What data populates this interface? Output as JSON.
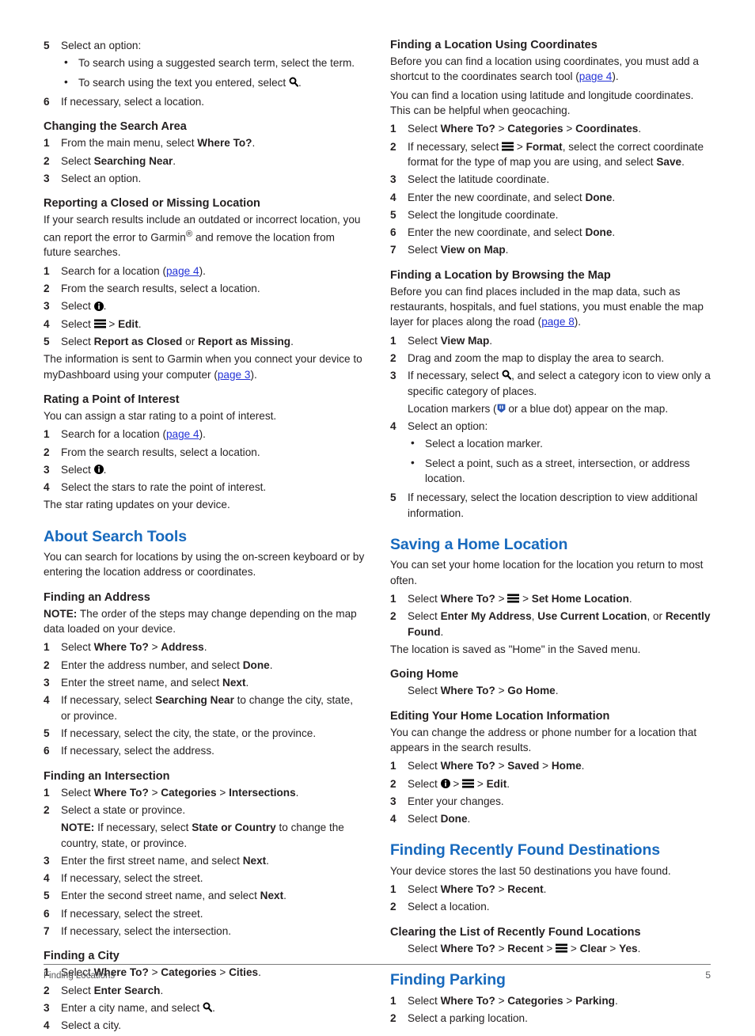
{
  "footer": {
    "section_title": "Finding Locations",
    "page_number": "5"
  },
  "colors": {
    "heading_blue": "#1769bd",
    "link_blue": "#2433d6",
    "body_text": "#231f20",
    "footer_text": "#58595b"
  },
  "icons": {
    "search": "search-icon",
    "menu": "menu-icon",
    "info": "info-icon",
    "marker": "map-marker-icon"
  },
  "left_column": {
    "step5_label": "5",
    "step5_text": "Select an option:",
    "step5_bullets": [
      {
        "marker": "•",
        "pre": "To search using a suggested search term, select the term.",
        "post": ""
      },
      {
        "marker": "•",
        "pre": "To search using the text you entered, select ",
        "post": "."
      }
    ],
    "step6_label": "6",
    "step6_text": "If necessary, select a location.",
    "changing_search_area": {
      "heading": "Changing the Search Area",
      "steps": [
        {
          "num": "1",
          "pre": "From the main menu, select ",
          "bold": "Where To?",
          "post": "."
        },
        {
          "num": "2",
          "pre": "Select ",
          "bold": "Searching Near",
          "post": "."
        },
        {
          "num": "3",
          "pre": "Select an option.",
          "bold": "",
          "post": ""
        }
      ]
    },
    "reporting_closed": {
      "heading": "Reporting a Closed or Missing Location",
      "intro_a": "If your search results include an outdated or incorrect location, you can report the error to Garmin",
      "intro_sup": "®",
      "intro_b": " and remove the location from future searches.",
      "step1_num": "1",
      "step1_pre": "Search for a location (",
      "step1_link": "page 4",
      "step1_post": ").",
      "step2_num": "2",
      "step2_text": "From the search results, select a location.",
      "step3_num": "3",
      "step3_pre": "Select ",
      "step3_post": ".",
      "step4_num": "4",
      "step4_pre": "Select ",
      "step4_mid": " > ",
      "step4_bold": "Edit",
      "step4_post": ".",
      "step5_num": "5",
      "step5_pre": "Select ",
      "step5_bold1": "Report as Closed",
      "step5_mid": " or ",
      "step5_bold2": "Report as Missing",
      "step5_post": ".",
      "outro_pre": "The information is sent to Garmin when you connect your device to myDashboard using your computer (",
      "outro_link": "page 3",
      "outro_post": ")."
    },
    "rating_poi": {
      "heading": "Rating a Point of Interest",
      "intro": "You can assign a star rating to a point of interest.",
      "step1_num": "1",
      "step1_pre": "Search for a location (",
      "step1_link": "page 4",
      "step1_post": ").",
      "step2_num": "2",
      "step2_text": "From the search results, select a location.",
      "step3_num": "3",
      "step3_pre": "Select ",
      "step3_post": ".",
      "step4_num": "4",
      "step4_text": "Select the stars to rate the point of interest.",
      "outro": "The star rating updates on your device."
    },
    "about_search_tools": {
      "heading": "About Search Tools",
      "intro": "You can search for locations by using the on-screen keyboard or by entering the location address or coordinates."
    },
    "finding_address": {
      "heading": "Finding an Address",
      "note_label": "NOTE:",
      "note_text": " The order of the steps may change depending on the map data loaded on your device.",
      "steps": [
        {
          "num": "1",
          "pre": "Select ",
          "bold": "Where To?",
          "mid": " > ",
          "bold2": "Address",
          "post": "."
        },
        {
          "num": "2",
          "pre": "Enter the address number, and select ",
          "bold": "Done",
          "mid": "",
          "bold2": "",
          "post": "."
        },
        {
          "num": "3",
          "pre": "Enter the street name, and select ",
          "bold": "Next",
          "mid": "",
          "bold2": "",
          "post": "."
        },
        {
          "num": "4",
          "pre": "If necessary, select ",
          "bold": "Searching Near",
          "mid": " to change the city, state, or province.",
          "bold2": "",
          "post": ""
        },
        {
          "num": "5",
          "pre": "If necessary, select the city, the state, or the province.",
          "bold": "",
          "mid": "",
          "bold2": "",
          "post": ""
        },
        {
          "num": "6",
          "pre": "If necessary, select the address.",
          "bold": "",
          "mid": "",
          "bold2": "",
          "post": ""
        }
      ]
    },
    "finding_intersection": {
      "heading": "Finding an Intersection",
      "step1_num": "1",
      "step1_pre": "Select ",
      "step1_b1": "Where To?",
      "step1_m1": " > ",
      "step1_b2": "Categories",
      "step1_m2": " > ",
      "step1_b3": "Intersections",
      "step1_post": ".",
      "step2_num": "2",
      "step2_text": "Select a state or province.",
      "step2_note_label": "NOTE:",
      "step2_note_pre": " If necessary, select ",
      "step2_note_bold": "State or Country",
      "step2_note_post": " to change the country, state, or province.",
      "steps_rest": [
        {
          "num": "3",
          "pre": "Enter the first street name, and select ",
          "bold": "Next",
          "post": "."
        },
        {
          "num": "4",
          "pre": "If necessary, select the street.",
          "bold": "",
          "post": ""
        },
        {
          "num": "5",
          "pre": "Enter the second street name, and select ",
          "bold": "Next",
          "post": "."
        },
        {
          "num": "6",
          "pre": "If necessary, select the street.",
          "bold": "",
          "post": ""
        },
        {
          "num": "7",
          "pre": "If necessary, select the intersection.",
          "bold": "",
          "post": ""
        }
      ]
    },
    "finding_city": {
      "heading": "Finding a City",
      "step1_num": "1",
      "step1_pre": "Select ",
      "step1_b1": "Where To?",
      "step1_m1": " > ",
      "step1_b2": "Categories",
      "step1_m2": " > ",
      "step1_b3": "Cities",
      "step1_post": ".",
      "step2_num": "2",
      "step2_pre": "Select ",
      "step2_bold": "Enter Search",
      "step2_post": ".",
      "step3_num": "3",
      "step3_pre": "Enter a city name, and select ",
      "step3_post": ".",
      "step4_num": "4",
      "step4_text": "Select a city."
    }
  },
  "right_column": {
    "finding_coordinates": {
      "heading": "Finding a Location Using Coordinates",
      "intro_pre": "Before you can find a location using coordinates, you must add a shortcut to the coordinates search tool (",
      "intro_link": "page 4",
      "intro_post": ").",
      "intro2": "You can find a location using latitude and longitude coordinates. This can be helpful when geocaching.",
      "step1_num": "1",
      "step1_pre": "Select ",
      "step1_b1": "Where To?",
      "step1_m1": " > ",
      "step1_b2": "Categories",
      "step1_m2": " > ",
      "step1_b3": "Coordinates",
      "step1_post": ".",
      "step2_num": "2",
      "step2_pre": "If necessary, select ",
      "step2_mid": " > ",
      "step2_bold": "Format",
      "step2_mid2": ", select the correct coordinate format for the type of map you are using, and select ",
      "step2_bold2": "Save",
      "step2_post": ".",
      "steps_rest": [
        {
          "num": "3",
          "pre": "Select the latitude coordinate.",
          "bold": "",
          "post": ""
        },
        {
          "num": "4",
          "pre": "Enter the new coordinate, and select ",
          "bold": "Done",
          "post": "."
        },
        {
          "num": "5",
          "pre": "Select the longitude coordinate.",
          "bold": "",
          "post": ""
        },
        {
          "num": "6",
          "pre": "Enter the new coordinate, and select ",
          "bold": "Done",
          "post": "."
        },
        {
          "num": "7",
          "pre": "Select ",
          "bold": "View on Map",
          "post": "."
        }
      ]
    },
    "browsing_map": {
      "heading": "Finding a Location by Browsing the Map",
      "intro_pre": "Before you can find places included in the map data, such as restaurants, hospitals, and fuel stations, you must enable the map layer for places along the road (",
      "intro_link": "page 8",
      "intro_post": ").",
      "step1_num": "1",
      "step1_pre": "Select ",
      "step1_bold": "View Map",
      "step1_post": ".",
      "step2_num": "2",
      "step2_text": "Drag and zoom the map to display the area to search.",
      "step3_num": "3",
      "step3_pre": "If necessary, select ",
      "step3_post": ", and select a category icon to view only a specific category of places.",
      "step3_sub_pre": "Location markers (",
      "step3_sub_post": " or a blue dot) appear on the map.",
      "step4_num": "4",
      "step4_text": "Select an option:",
      "step4_bullets": [
        {
          "marker": "•",
          "text": "Select a location marker."
        },
        {
          "marker": "•",
          "text": "Select a point, such as a street, intersection, or address location."
        }
      ],
      "step5_num": "5",
      "step5_text": "If necessary, select the location description to view additional information."
    },
    "saving_home": {
      "heading": "Saving a Home Location",
      "intro": "You can set your home location for the location you return to most often.",
      "step1_num": "1",
      "step1_pre": "Select ",
      "step1_bold": "Where To?",
      "step1_m1": " > ",
      "step1_m2": " > ",
      "step1_bold2": "Set Home Location",
      "step1_post": ".",
      "step2_num": "2",
      "step2_pre": "Select ",
      "step2_b1": "Enter My Address",
      "step2_m1": ", ",
      "step2_b2": "Use Current Location",
      "step2_m2": ", or ",
      "step2_b3": "Recently Found",
      "step2_post": ".",
      "outro": "The location is saved as \"Home\" in the Saved menu."
    },
    "going_home": {
      "heading": "Going Home",
      "pre": "Select ",
      "b1": "Where To?",
      "m1": " > ",
      "b2": "Go Home",
      "post": "."
    },
    "editing_home": {
      "heading": "Editing Your Home Location Information",
      "intro": "You can change the address or phone number for a location that appears in the search results.",
      "step1_num": "1",
      "step1_pre": "Select ",
      "step1_b1": "Where To?",
      "step1_m1": " > ",
      "step1_b2": "Saved",
      "step1_m2": " > ",
      "step1_b3": "Home",
      "step1_post": ".",
      "step2_num": "2",
      "step2_pre": "Select ",
      "step2_m1": " > ",
      "step2_m2": " > ",
      "step2_bold": "Edit",
      "step2_post": ".",
      "step3_num": "3",
      "step3_text": "Enter your changes.",
      "step4_num": "4",
      "step4_pre": "Select ",
      "step4_bold": "Done",
      "step4_post": "."
    },
    "recently_found": {
      "heading": "Finding Recently Found Destinations",
      "intro": "Your device stores the last 50 destinations you have found.",
      "step1_num": "1",
      "step1_pre": "Select ",
      "step1_b1": "Where To?",
      "step1_m1": " > ",
      "step1_b2": "Recent",
      "step1_post": ".",
      "step2_num": "2",
      "step2_text": "Select a location."
    },
    "clearing_list": {
      "heading": "Clearing the List of Recently Found Locations",
      "pre": "Select ",
      "b1": "Where To?",
      "m1": " > ",
      "b2": "Recent",
      "m2": " > ",
      "m3": " > ",
      "b3": "Clear",
      "m4": " > ",
      "b4": "Yes",
      "post": "."
    },
    "finding_parking": {
      "heading": "Finding Parking",
      "step1_num": "1",
      "step1_pre": "Select ",
      "step1_b1": "Where To?",
      "step1_m1": " > ",
      "step1_b2": "Categories",
      "step1_m2": " > ",
      "step1_b3": "Parking",
      "step1_post": ".",
      "step2_num": "2",
      "step2_text": "Select a parking location."
    }
  }
}
